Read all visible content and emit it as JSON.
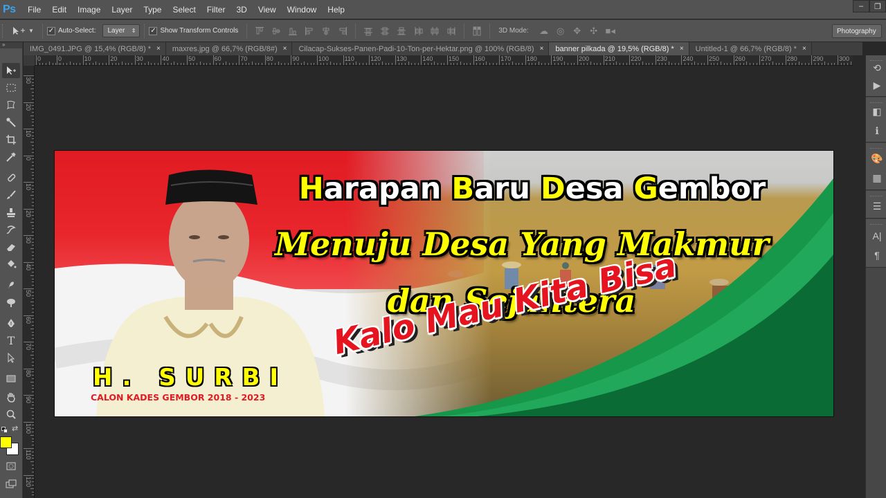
{
  "app": {
    "logo": "Ps",
    "menu": [
      "File",
      "Edit",
      "Image",
      "Layer",
      "Type",
      "Select",
      "Filter",
      "3D",
      "View",
      "Window",
      "Help"
    ],
    "window_controls": {
      "minimize": "–",
      "restore": "❐"
    }
  },
  "options_bar": {
    "tool_icon": "move-tool-icon",
    "auto_select_label": "Auto-Select:",
    "auto_select_checked": true,
    "auto_select_target": "Layer",
    "show_transform_label": "Show Transform Controls",
    "show_transform_checked": true,
    "align_icons": [
      "align-top-edges",
      "align-vertical-centers",
      "align-bottom-edges",
      "align-left-edges",
      "align-horizontal-centers",
      "align-right-edges"
    ],
    "distribute_icons": [
      "distribute-top",
      "distribute-vertical-centers",
      "distribute-bottom",
      "distribute-left",
      "distribute-horizontal-centers",
      "distribute-right"
    ],
    "auto_align_icon": "auto-align-layers",
    "mode_label": "3D Mode:",
    "mode_icons": [
      "3d-rotate",
      "3d-roll",
      "3d-pan",
      "3d-slide",
      "3d-scale"
    ],
    "workspace": "Photography"
  },
  "tabs": [
    {
      "label": "IMG_0491.JPG @ 15,4% (RGB/8) *",
      "active": false
    },
    {
      "label": "maxres.jpg @ 66,7% (RGB/8#)",
      "active": false
    },
    {
      "label": "Cilacap-Sukses-Panen-Padi-10-Ton-per-Hektar.png @ 100% (RGB/8)",
      "active": false
    },
    {
      "label": "banner pilkada @ 19,5% (RGB/8) *",
      "active": true
    },
    {
      "label": "Untitled-1 @ 66,7% (RGB/8) *",
      "active": false
    }
  ],
  "tab_close": "×",
  "rulers": {
    "horizontal": [
      "0",
      "0",
      "10",
      "20",
      "30",
      "40",
      "50",
      "60",
      "70",
      "80",
      "90",
      "100",
      "110",
      "120",
      "130",
      "140",
      "150",
      "160",
      "170",
      "180",
      "190",
      "200",
      "210",
      "220",
      "230",
      "240",
      "250",
      "260",
      "270",
      "280",
      "290",
      "300"
    ],
    "vertical": [
      "30",
      "20",
      "10",
      "0",
      "10",
      "20",
      "30",
      "40",
      "50",
      "60",
      "70",
      "80",
      "90",
      "100",
      "110",
      "120"
    ]
  },
  "tools": [
    "move-tool",
    "marquee-tool",
    "lasso-tool",
    "magic-wand-tool",
    "crop-tool",
    "eyedropper-tool",
    "healing-brush-tool",
    "brush-tool",
    "clone-stamp-tool",
    "history-brush-tool",
    "eraser-tool",
    "paint-bucket-tool",
    "blur-tool",
    "dodge-tool",
    "pen-tool",
    "type-tool",
    "path-selection-tool",
    "rectangle-tool",
    "hand-tool",
    "zoom-tool"
  ],
  "colors": {
    "foreground": "#ffff00",
    "background": "#ffffff"
  },
  "dock_panels": [
    "history",
    "actions",
    "adjustments",
    "info",
    "swatches",
    "color",
    "tool-presets",
    "character",
    "paragraph"
  ],
  "banner": {
    "headline_words": [
      {
        "cap": "H",
        "rest": "arapan"
      },
      {
        "cap": "B",
        "rest": "aru"
      },
      {
        "cap": "D",
        "rest": "esa"
      },
      {
        "cap": "G",
        "rest": "embor"
      }
    ],
    "tagline_1": "Menuju Desa Yang Makmur",
    "tagline_2": "dan Sejahtera",
    "slogan": "Kalo Mau Kita Bisa",
    "candidate_name": "H. SURBI",
    "candidate_subtitle": "CALON KADES GEMBOR 2018 - 2023",
    "accent_colors": {
      "flag_red": "#e21b23",
      "yellow": "#ffff00",
      "green_dark": "#0b6b34",
      "green_light": "#21a85a"
    }
  }
}
